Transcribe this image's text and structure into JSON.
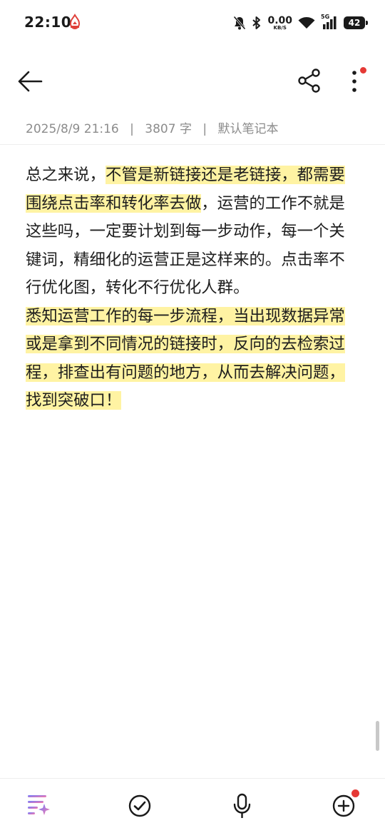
{
  "status_bar": {
    "time": "22:10",
    "net_speed_value": "0.00",
    "net_speed_unit": "KB/S",
    "signal_label": "5G",
    "battery_level": "42",
    "icons": [
      "flame-app-icon",
      "mute-bell-icon",
      "bluetooth-icon",
      "wifi-icon",
      "signal-icon",
      "battery-icon"
    ]
  },
  "toolbar_top": {
    "icons": [
      "back-arrow-icon",
      "share-icon",
      "more-vertical-icon"
    ],
    "more_has_badge": true
  },
  "meta": {
    "date": "2025/8/9 21:16",
    "separator": "|",
    "word_count": "3807 字",
    "notebook": "默认笔记本"
  },
  "note": {
    "p1_plain_a": "总之来说，",
    "p1_highlight": "不管是新链接还是老链接，都需要围绕点击率和转化率去做",
    "p1_plain_b": "，运营的工作不就是这些吗，一定要计划到每一步动作，每一个关键词，精细化的运营正是这样来的。点击率不行优化图，转化不行优化人群。",
    "p2_highlight": "悉知运营工作的每一步流程，当出现数据异常或是拿到不同情况的链接时，反向的去检索过程，排查出有问题的地方，从而去解决问题，找到突破口！"
  },
  "bottom_toolbar": {
    "icons": [
      "ai-sparkle-icon",
      "checklist-icon",
      "microphone-icon",
      "add-circle-icon"
    ],
    "add_has_badge": true
  },
  "colors": {
    "highlight": "#fff3a3",
    "badge": "#e53935",
    "meta_text": "#8c8c8c",
    "ai_gradient_start": "#6a7cff",
    "ai_gradient_end": "#ff7aa8"
  }
}
